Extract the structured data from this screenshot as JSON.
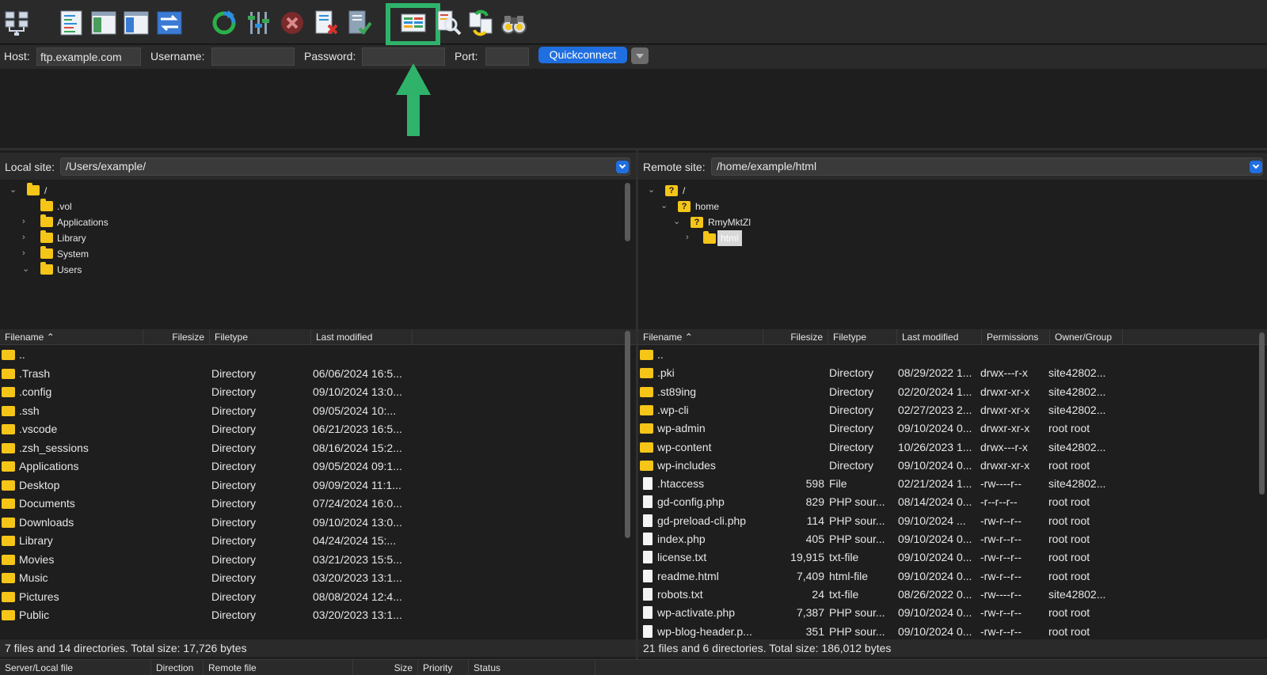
{
  "toolbar": {
    "icons": [
      "site-manager-icon",
      "toggle-message-log-icon",
      "toggle-local-tree-icon",
      "toggle-remote-tree-icon",
      "toggle-transfer-queue-icon",
      "refresh-icon",
      "process-queue-icon",
      "cancel-icon",
      "disconnect-icon",
      "reconnect-icon",
      "directory-listing-filters-icon",
      "toggle-filename-filters-icon",
      "synchronized-browsing-icon",
      "search-icon"
    ],
    "highlight_color": "#2fb36b"
  },
  "quickconnect": {
    "host_label": "Host:",
    "host_value": "ftp.example.com",
    "username_label": "Username:",
    "username_value": "",
    "password_label": "Password:",
    "password_value": "",
    "port_label": "Port:",
    "port_value": "",
    "button_label": "Quickconnect"
  },
  "local": {
    "site_label": "Local site:",
    "path": "/Users/example/",
    "tree": [
      {
        "label": "/",
        "expanded": true,
        "has_children": true
      },
      {
        "label": ".vol",
        "has_children": false
      },
      {
        "label": "Applications",
        "has_children": true
      },
      {
        "label": "Library",
        "has_children": true
      },
      {
        "label": "System",
        "has_children": true
      },
      {
        "label": "Users",
        "expanded": true,
        "has_children": true
      }
    ],
    "columns": [
      "Filename",
      "Filesize",
      "Filetype",
      "Last modified"
    ],
    "rows": [
      {
        "name": "..",
        "size": "",
        "type": "",
        "modified": ""
      },
      {
        "name": ".Trash",
        "size": "",
        "type": "Directory",
        "modified": "06/06/2024 16:5..."
      },
      {
        "name": ".config",
        "size": "",
        "type": "Directory",
        "modified": "09/10/2024 13:0..."
      },
      {
        "name": ".ssh",
        "size": "",
        "type": "Directory",
        "modified": "09/05/2024 10:..."
      },
      {
        "name": ".vscode",
        "size": "",
        "type": "Directory",
        "modified": "06/21/2023 16:5..."
      },
      {
        "name": ".zsh_sessions",
        "size": "",
        "type": "Directory",
        "modified": "08/16/2024 15:2..."
      },
      {
        "name": "Applications",
        "size": "",
        "type": "Directory",
        "modified": "09/05/2024 09:1..."
      },
      {
        "name": "Desktop",
        "size": "",
        "type": "Directory",
        "modified": "09/09/2024 11:1..."
      },
      {
        "name": "Documents",
        "size": "",
        "type": "Directory",
        "modified": "07/24/2024 16:0..."
      },
      {
        "name": "Downloads",
        "size": "",
        "type": "Directory",
        "modified": "09/10/2024 13:0..."
      },
      {
        "name": "Library",
        "size": "",
        "type": "Directory",
        "modified": "04/24/2024 15:..."
      },
      {
        "name": "Movies",
        "size": "",
        "type": "Directory",
        "modified": "03/21/2023 15:5..."
      },
      {
        "name": "Music",
        "size": "",
        "type": "Directory",
        "modified": "03/20/2023 13:1..."
      },
      {
        "name": "Pictures",
        "size": "",
        "type": "Directory",
        "modified": "08/08/2024 12:4..."
      },
      {
        "name": "Public",
        "size": "",
        "type": "Directory",
        "modified": "03/20/2023 13:1..."
      }
    ],
    "status": "7 files and 14 directories. Total size: 17,726 bytes"
  },
  "remote": {
    "site_label": "Remote site:",
    "path": "/home/example/html",
    "tree": [
      {
        "label": "/",
        "unknown": true
      },
      {
        "label": "home",
        "unknown": true
      },
      {
        "label": "RmyMktZl",
        "unknown": true
      },
      {
        "label": "html",
        "selected": true
      }
    ],
    "columns": [
      "Filename",
      "Filesize",
      "Filetype",
      "Last modified",
      "Permissions",
      "Owner/Group"
    ],
    "rows": [
      {
        "name": "..",
        "size": "",
        "type": "",
        "modified": "",
        "perms": "",
        "owner": "",
        "is_dir": true
      },
      {
        "name": ".pki",
        "size": "",
        "type": "Directory",
        "modified": "08/29/2022 1...",
        "perms": "drwx---r-x",
        "owner": "site42802...",
        "is_dir": true
      },
      {
        "name": ".st89ing",
        "size": "",
        "type": "Directory",
        "modified": "02/20/2024 1...",
        "perms": "drwxr-xr-x",
        "owner": "site42802...",
        "is_dir": true
      },
      {
        "name": ".wp-cli",
        "size": "",
        "type": "Directory",
        "modified": "02/27/2023 2...",
        "perms": "drwxr-xr-x",
        "owner": "site42802...",
        "is_dir": true
      },
      {
        "name": "wp-admin",
        "size": "",
        "type": "Directory",
        "modified": "09/10/2024 0...",
        "perms": "drwxr-xr-x",
        "owner": "root root",
        "is_dir": true
      },
      {
        "name": "wp-content",
        "size": "",
        "type": "Directory",
        "modified": "10/26/2023 1...",
        "perms": "drwx---r-x",
        "owner": "site42802...",
        "is_dir": true
      },
      {
        "name": "wp-includes",
        "size": "",
        "type": "Directory",
        "modified": "09/10/2024 0...",
        "perms": "drwxr-xr-x",
        "owner": "root root",
        "is_dir": true
      },
      {
        "name": ".htaccess",
        "size": "598",
        "type": "File",
        "modified": "02/21/2024 1...",
        "perms": "-rw----r--",
        "owner": "site42802...",
        "is_dir": false
      },
      {
        "name": "gd-config.php",
        "size": "829",
        "type": "PHP sour...",
        "modified": "08/14/2024 0...",
        "perms": "-r--r--r--",
        "owner": "root root",
        "is_dir": false
      },
      {
        "name": "gd-preload-cli.php",
        "size": "114",
        "type": "PHP sour...",
        "modified": "09/10/2024 ...",
        "perms": "-rw-r--r--",
        "owner": "root root",
        "is_dir": false
      },
      {
        "name": "index.php",
        "size": "405",
        "type": "PHP sour...",
        "modified": "09/10/2024 0...",
        "perms": "-rw-r--r--",
        "owner": "root root",
        "is_dir": false
      },
      {
        "name": "license.txt",
        "size": "19,915",
        "type": "txt-file",
        "modified": "09/10/2024 0...",
        "perms": "-rw-r--r--",
        "owner": "root root",
        "is_dir": false
      },
      {
        "name": "readme.html",
        "size": "7,409",
        "type": "html-file",
        "modified": "09/10/2024 0...",
        "perms": "-rw-r--r--",
        "owner": "root root",
        "is_dir": false
      },
      {
        "name": "robots.txt",
        "size": "24",
        "type": "txt-file",
        "modified": "08/26/2022 0...",
        "perms": "-rw----r--",
        "owner": "site42802...",
        "is_dir": false
      },
      {
        "name": "wp-activate.php",
        "size": "7,387",
        "type": "PHP sour...",
        "modified": "09/10/2024 0...",
        "perms": "-rw-r--r--",
        "owner": "root root",
        "is_dir": false
      },
      {
        "name": "wp-blog-header.p...",
        "size": "351",
        "type": "PHP sour...",
        "modified": "09/10/2024 0...",
        "perms": "-rw-r--r--",
        "owner": "root root",
        "is_dir": false
      }
    ],
    "status": "21 files and 6 directories. Total size: 186,012 bytes"
  },
  "queue": {
    "columns": [
      "Server/Local file",
      "Direction",
      "Remote file",
      "Size",
      "Priority",
      "Status"
    ]
  }
}
